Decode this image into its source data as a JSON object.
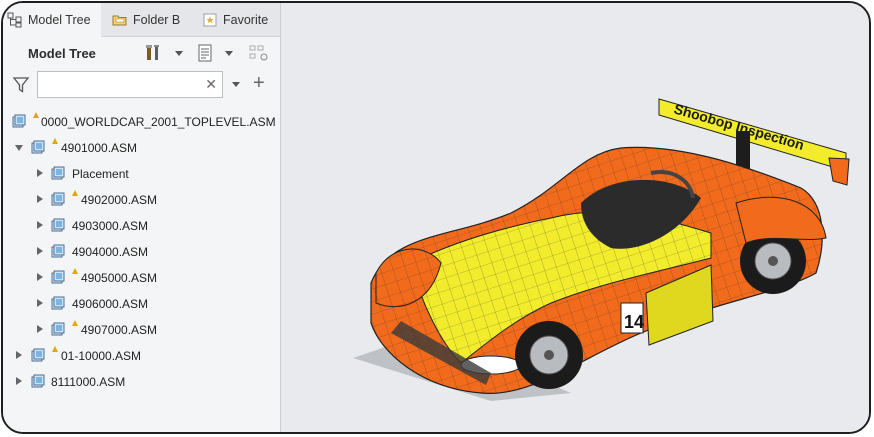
{
  "tabs": [
    {
      "label": "Model Tree",
      "icon": "model-tree-icon"
    },
    {
      "label": "Folder B",
      "icon": "folder-browser-icon"
    },
    {
      "label": "Favorite",
      "icon": "favorites-icon"
    }
  ],
  "panel": {
    "title": "Model Tree",
    "filter": {
      "value": "",
      "placeholder": ""
    }
  },
  "tree": [
    {
      "label": "0000_WORLDCAR_2001_TOPLEVEL.ASM",
      "level": 0,
      "expander": "none",
      "warning": true
    },
    {
      "label": "4901000.ASM",
      "level": 1,
      "expander": "expanded",
      "warning": true
    },
    {
      "label": "Placement",
      "level": 2,
      "expander": "collapsed",
      "warning": false
    },
    {
      "label": "4902000.ASM",
      "level": 2,
      "expander": "collapsed",
      "warning": true
    },
    {
      "label": "4903000.ASM",
      "level": 2,
      "expander": "collapsed",
      "warning": false
    },
    {
      "label": "4904000.ASM",
      "level": 2,
      "expander": "collapsed",
      "warning": false
    },
    {
      "label": "4905000.ASM",
      "level": 2,
      "expander": "collapsed",
      "warning": true
    },
    {
      "label": "4906000.ASM",
      "level": 2,
      "expander": "collapsed",
      "warning": false
    },
    {
      "label": "4907000.ASM",
      "level": 2,
      "expander": "collapsed",
      "warning": true
    },
    {
      "label": "01-10000.ASM",
      "level": 1,
      "expander": "collapsed",
      "warning": true
    },
    {
      "label": "8111000.ASM",
      "level": 1,
      "expander": "collapsed",
      "warning": false
    }
  ],
  "model": {
    "wing_text": "Shoobop Inspection",
    "race_number": "14",
    "colors": {
      "orange": "#f26a1b",
      "yellow": "#f2ec2c",
      "mesh": "#2a2a2a",
      "background": "#e8eaed"
    }
  }
}
